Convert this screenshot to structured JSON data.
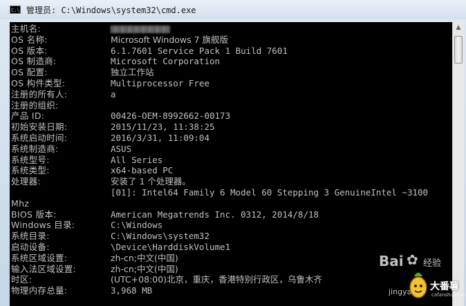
{
  "window": {
    "title": "管理员: C:\\Windows\\system32\\cmd.exe",
    "icon": "cmd-console-icon"
  },
  "console": {
    "lines": [
      {
        "label": "主机名:",
        "value": "",
        "redacted": true
      },
      {
        "label": "OS 名称:",
        "value": "Microsoft Windows 7 旗舰版"
      },
      {
        "label": "OS 版本:",
        "value": "6.1.7601 Service Pack 1 Build 7601"
      },
      {
        "label": "OS 制造商:",
        "value": "Microsoft Corporation"
      },
      {
        "label": "OS 配置:",
        "value": "独立工作站"
      },
      {
        "label": "OS 构件类型:",
        "value": "Multiprocessor Free"
      },
      {
        "label": "注册的所有人:",
        "value": "a"
      },
      {
        "label": "注册的组织:",
        "value": ""
      },
      {
        "label": "产品 ID:",
        "value": "00426-OEM-8992662-00173"
      },
      {
        "label": "初始安装日期:",
        "value": "2015/11/23, 11:38:25"
      },
      {
        "label": "系统启动时间:",
        "value": "2016/3/31, 11:09:04"
      },
      {
        "label": "系统制造商:",
        "value": "ASUS"
      },
      {
        "label": "系统型号:",
        "value": "All Series"
      },
      {
        "label": "系统类型:",
        "value": "x64-based PC"
      },
      {
        "label": "处理器:",
        "value": "安装了 1 个处理器。"
      },
      {
        "label": "",
        "value": "[01]: Intel64 Family 6 Model 60 Stepping 3 GenuineIntel ~3100"
      },
      {
        "label": "Mhz",
        "value": ""
      },
      {
        "label": "BIOS 版本:",
        "value": "American Megatrends Inc. 0312, 2014/8/18"
      },
      {
        "label": "Windows 目录:",
        "value": "C:\\Windows"
      },
      {
        "label": "系统目录:",
        "value": "C:\\Windows\\system32"
      },
      {
        "label": "启动设备:",
        "value": "\\Device\\HarddiskVolume1"
      },
      {
        "label": "系统区域设置:",
        "value": "zh-cn;中文(中国)"
      },
      {
        "label": "输入法区域设置:",
        "value": "zh-cn;中文(中国)"
      },
      {
        "label": "时区:",
        "value": "(UTC+08:00)北京，重庆，香港特别行政区，乌鲁木齐"
      },
      {
        "label": "物理内存总量:",
        "value": "3,968 MB"
      }
    ]
  },
  "watermark": {
    "brand": "Bai",
    "brand_suffix": "经验",
    "site": "jingyan.b",
    "site2": "cafanshu.com",
    "logo_text": "大番薯"
  },
  "colors": {
    "console_bg": "#000000",
    "console_fg": "#c0c0c0",
    "titlebar": "#dfe9f3"
  }
}
